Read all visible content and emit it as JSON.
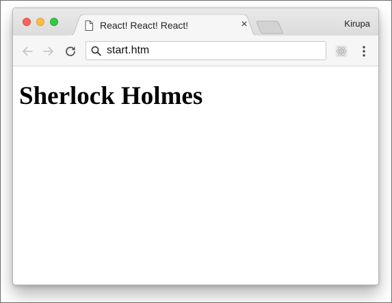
{
  "browser": {
    "tab": {
      "title": "React! React! React!",
      "close_glyph": "×"
    },
    "profile_name": "Kirupa",
    "address_bar": {
      "url": "start.htm"
    }
  },
  "page": {
    "heading": "Sherlock Holmes"
  },
  "colors": {
    "close_light": "#fc605b",
    "minimize_light": "#fdbc40",
    "zoom_light": "#34c84a",
    "titlebar": "#e3e3e3",
    "toolbar": "#f6f6f6",
    "page_background": "#ffffff"
  },
  "icons": [
    "document-icon",
    "close-icon",
    "back-arrow-icon",
    "forward-arrow-icon",
    "reload-icon",
    "search-icon",
    "react-extension-icon",
    "kebab-menu-icon"
  ]
}
